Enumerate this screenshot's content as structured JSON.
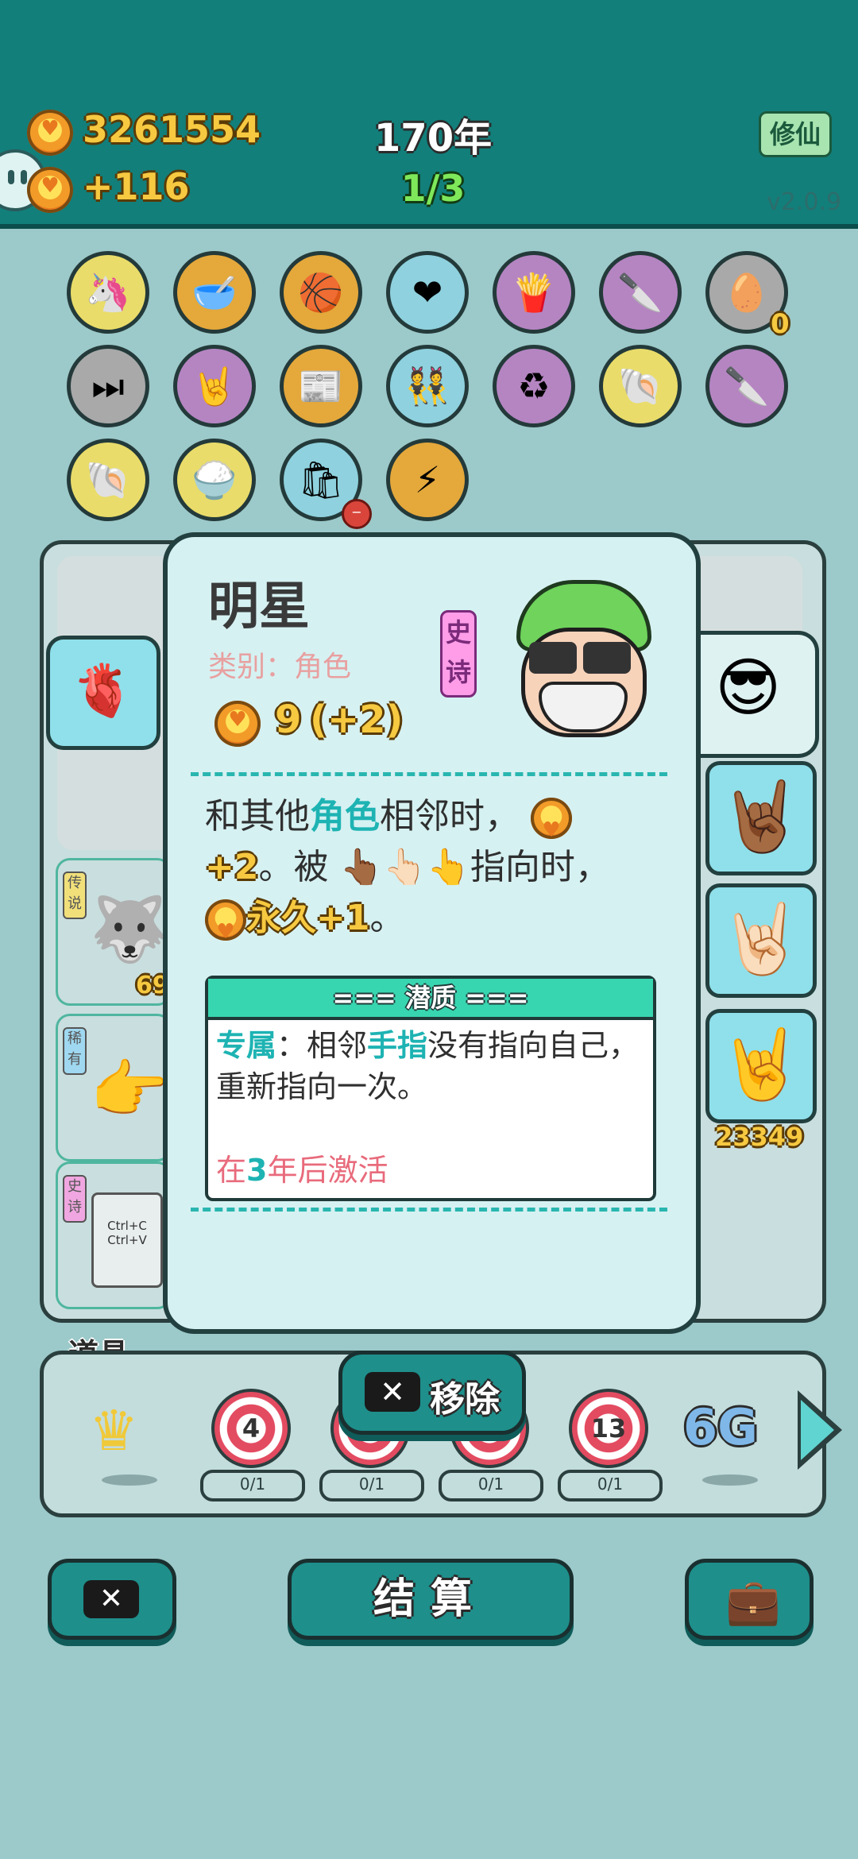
{
  "hud": {
    "coins": "3261554",
    "income": "+116",
    "year": "170年",
    "progress": "1/3",
    "xiuxian_label": "修仙",
    "version": "v2.0.9"
  },
  "items": {
    "row1_count_badge": "0"
  },
  "board": {
    "left_cards": [
      {
        "rarity": "传说",
        "value": "69"
      },
      {
        "rarity": "稀有",
        "value": ""
      },
      {
        "rarity": "史诗",
        "keys": "Ctrl+C\nCtrl+V"
      }
    ],
    "right_value": "23349"
  },
  "popup": {
    "name": "明星",
    "category": "类别：角色",
    "rarity": "史诗",
    "coin_value": "9",
    "coin_bonus": "(+2)",
    "desc": {
      "p1": "和其他",
      "p1_hl": "角色",
      "p1_end": "相邻时，",
      "p2": "+2",
      "p2_mid": "。被",
      "p2_end": "指向时，",
      "p3_hl": "永久+1",
      "p3_end": "。"
    },
    "potential": {
      "header": "=== 潜质 ===",
      "label": "专属",
      "text1": "：相邻",
      "hl": "手指",
      "text2": "没有指向自己，重新指向一次。",
      "activation_pre": "在",
      "activation_num": "3",
      "activation_post": "年后激活"
    },
    "remove_label": "移除"
  },
  "tools": {
    "title": "道具",
    "targets": [
      {
        "num": "4",
        "count": "0/1"
      },
      {
        "num": "",
        "count": "0/1"
      },
      {
        "num": "",
        "count": "0/1"
      },
      {
        "num": "13",
        "count": "0/1"
      }
    ],
    "six_g": "6G"
  },
  "bottom": {
    "settle_label": "结算"
  },
  "colors": {
    "teal": "#127f7b",
    "accent": "#29b6b0",
    "gold": "#f6c941",
    "pink": "#e86b7c"
  }
}
